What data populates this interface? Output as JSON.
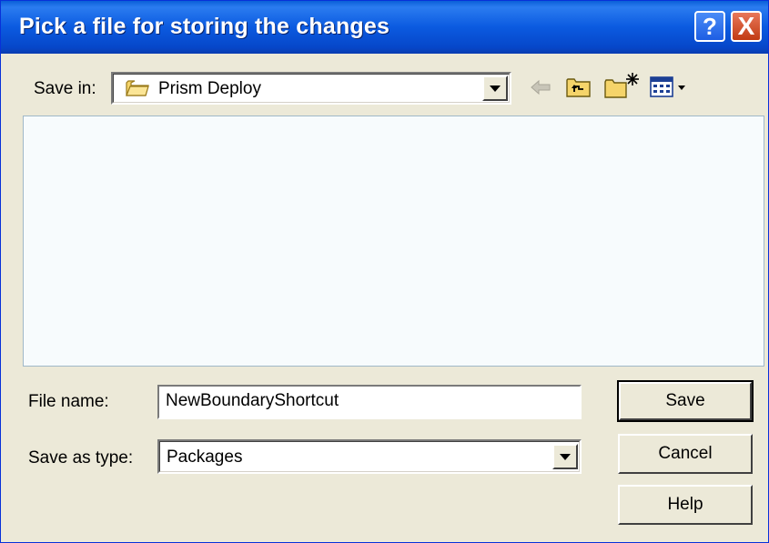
{
  "window": {
    "title": "Pick a file for storing the changes",
    "help_glyph": "?",
    "close_glyph": "X"
  },
  "save_in": {
    "label": "Save in:",
    "value": "Prism Deploy"
  },
  "toolbar": {
    "icons": [
      "back-arrow-icon",
      "up-folder-icon",
      "new-folder-icon",
      "views-menu-icon"
    ]
  },
  "file_name": {
    "label": "File name:",
    "value": "NewBoundaryShortcut"
  },
  "save_as_type": {
    "label": "Save as type:",
    "value": "Packages"
  },
  "buttons": {
    "save": "Save",
    "cancel": "Cancel",
    "help": "Help"
  },
  "colors": {
    "titlebar": "#0a5fd8",
    "dialog_bg": "#ece9d8",
    "close_button": "#c13a12"
  }
}
